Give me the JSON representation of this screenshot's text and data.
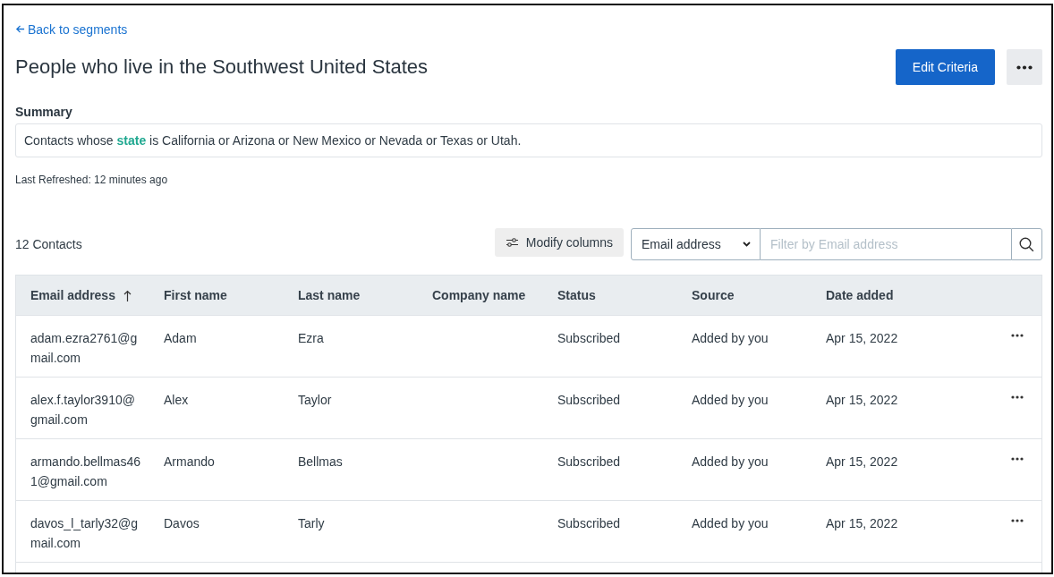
{
  "back_link": "Back to segments",
  "title": "People who live in the Southwest United States",
  "edit_button": "Edit Criteria",
  "summary": {
    "label": "Summary",
    "text": "Contacts whose **state** is California or Arizona or New Mexico or Nevada or Texas or Utah."
  },
  "last_refreshed": "Last Refreshed: 12 minutes ago",
  "contacts_count": "12 Contacts",
  "modify_columns_button": "Modify columns",
  "filter": {
    "field": "Email address",
    "placeholder": "Filter by Email address"
  },
  "table": {
    "columns": [
      {
        "label": "Email address",
        "sorted": true
      },
      {
        "label": "First name",
        "sorted": false
      },
      {
        "label": "Last name",
        "sorted": false
      },
      {
        "label": "Company name",
        "sorted": false
      },
      {
        "label": "Status",
        "sorted": false
      },
      {
        "label": "Source",
        "sorted": false
      },
      {
        "label": "Date added",
        "sorted": false
      }
    ],
    "rows": [
      [
        "adam.ezra2761@gmail.com",
        "Adam",
        "Ezra",
        "",
        "Subscribed",
        "Added by you",
        "Apr 15, 2022"
      ],
      [
        "alex.f.taylor3910@gmail.com",
        "Alex",
        "Taylor",
        "",
        "Subscribed",
        "Added by you",
        "Apr 15, 2022"
      ],
      [
        "armando.bellmas461@gmail.com",
        "Armando",
        "Bellmas",
        "",
        "Subscribed",
        "Added by you",
        "Apr 15, 2022"
      ],
      [
        "davos_l_tarly32@gmail.com",
        "Davos",
        "Tarly",
        "",
        "Subscribed",
        "Added by you",
        "Apr 15, 2022"
      ]
    ]
  }
}
